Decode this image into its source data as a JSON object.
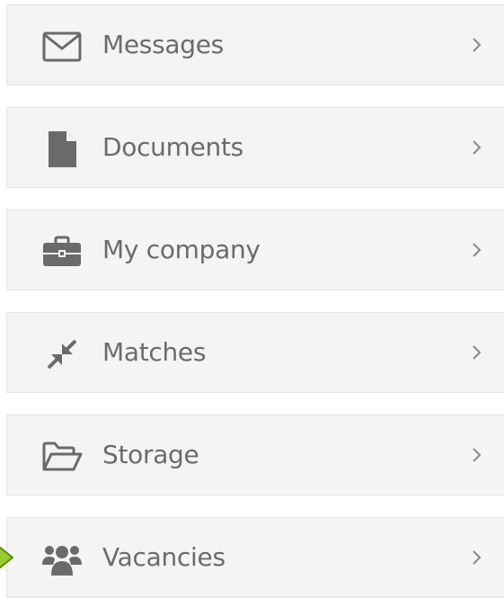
{
  "menu": {
    "items": [
      {
        "label": "Messages",
        "icon": "envelope-icon"
      },
      {
        "label": "Documents",
        "icon": "document-icon"
      },
      {
        "label": "My company",
        "icon": "briefcase-icon"
      },
      {
        "label": "Matches",
        "icon": "compress-arrows-icon"
      },
      {
        "label": "Storage",
        "icon": "folder-open-icon"
      },
      {
        "label": "Vacancies",
        "icon": "users-group-icon"
      }
    ],
    "chevron_icon": "chevron-right-icon"
  },
  "colors": {
    "item_background": "#f4f4f4",
    "item_border": "#e3e3e3",
    "text": "#6b6b6b",
    "icon": "#6a6a6a",
    "chevron": "#8a8a8a",
    "pointer_arrow": "#9acd32"
  }
}
